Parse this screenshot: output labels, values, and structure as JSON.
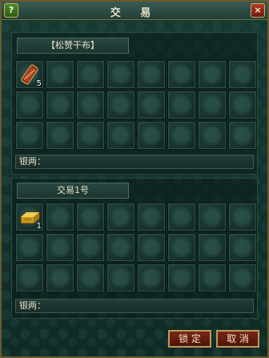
{
  "window": {
    "title": "交 易",
    "help_glyph": "?",
    "close_glyph": "×"
  },
  "partner": {
    "name_label": "【松赞干布】",
    "money_label": "银两：",
    "slots": [
      {
        "item": "scroll-item",
        "count": "5"
      }
    ]
  },
  "self": {
    "name_label": "交易1号",
    "money_label": "银两：",
    "slots": [
      {
        "item": "gold-ingot-item",
        "count": "1"
      }
    ]
  },
  "buttons": {
    "lock": "锁 定",
    "cancel": "取 消"
  }
}
